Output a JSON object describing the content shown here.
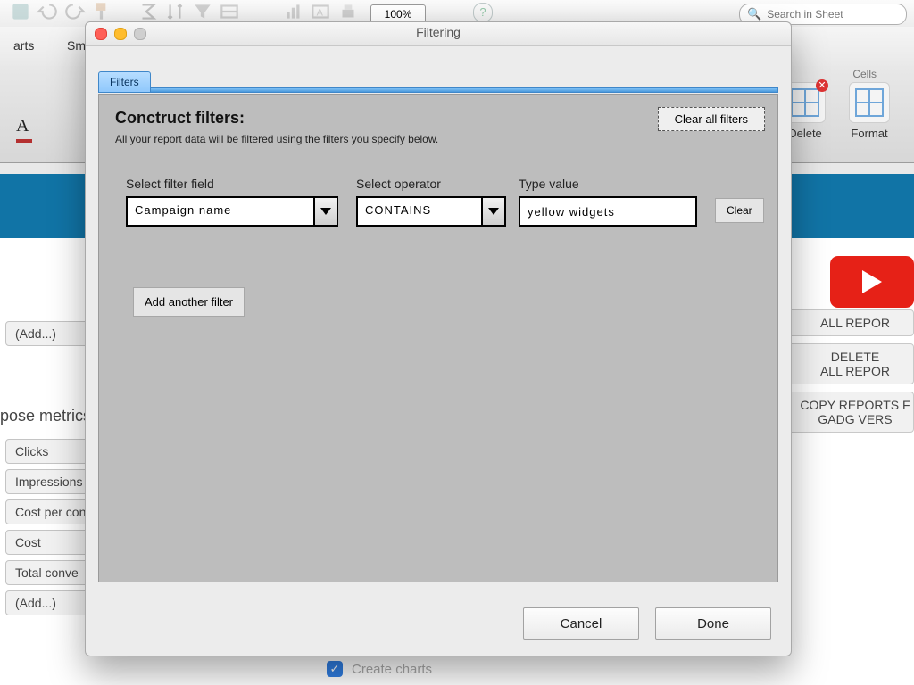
{
  "bg": {
    "zoom": "100%",
    "search_placeholder": "Search in Sheet",
    "ribbon_tab_left": "arts",
    "ribbon_tab_sm": "Sm",
    "cells_group_label": "Cells",
    "delete_label": "Delete",
    "format_label": "Format",
    "metrics_header": "pose metrics",
    "add_chip": "(Add...)",
    "metric_chips": [
      "Clicks",
      "Impressions",
      "Cost per con",
      "Cost",
      "Total conve",
      "(Add...)"
    ],
    "right_buttons": [
      "ALL REPOR",
      "DELETE\nALL REPOR",
      "COPY REPORTS F\nGADG VERS"
    ],
    "create_charts_label": "Create charts"
  },
  "dialog": {
    "title": "Filtering",
    "tab_label": "Filters",
    "heading": "Conctruct filters:",
    "subtitle": "All your report data will be filtered using the filters you specify below.",
    "clear_all_label": "Clear all filters",
    "col_field_label": "Select filter field",
    "col_op_label": "Select operator",
    "col_val_label": "Type value",
    "row": {
      "field": "Campaign name",
      "operator": "CONTAINS",
      "value": "yellow widgets"
    },
    "clear_row_label": "Clear",
    "add_another_label": "Add another filter",
    "cancel_label": "Cancel",
    "done_label": "Done"
  }
}
